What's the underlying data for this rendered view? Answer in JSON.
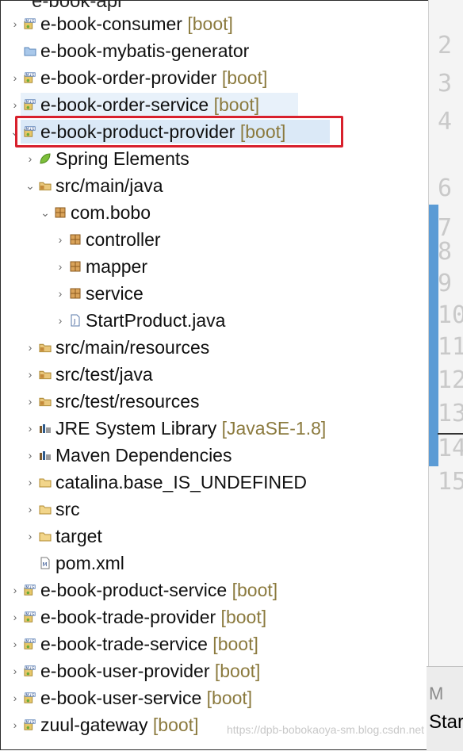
{
  "partial_title": "e-book-api",
  "tree": [
    {
      "label": "e-book-consumer",
      "decoration": "[boot]",
      "icon": "boot-project-icon",
      "arrow": "›",
      "indent": 0
    },
    {
      "label": "e-book-mybatis-generator",
      "decoration": "",
      "icon": "project-folder-icon",
      "arrow": "",
      "indent": 0
    },
    {
      "label": "e-book-order-provider",
      "decoration": "[boot]",
      "icon": "boot-project-icon",
      "arrow": "›",
      "indent": 0
    },
    {
      "label": "e-book-order-service",
      "decoration": "[boot]",
      "icon": "boot-project-icon",
      "arrow": "›",
      "indent": 0
    },
    {
      "label": "e-book-product-provider",
      "decoration": "[boot]",
      "icon": "boot-project-icon",
      "arrow": "⌄",
      "indent": 0
    },
    {
      "label": "Spring Elements",
      "decoration": "",
      "icon": "spring-leaf-icon",
      "arrow": "›",
      "indent": 1
    },
    {
      "label": "src/main/java",
      "decoration": "",
      "icon": "source-folder-icon",
      "arrow": "⌄",
      "indent": 1
    },
    {
      "label": "com.bobo",
      "decoration": "",
      "icon": "package-icon",
      "arrow": "⌄",
      "indent": 2
    },
    {
      "label": "controller",
      "decoration": "",
      "icon": "package-icon",
      "arrow": "›",
      "indent": 3
    },
    {
      "label": "mapper",
      "decoration": "",
      "icon": "package-icon",
      "arrow": "›",
      "indent": 3
    },
    {
      "label": "service",
      "decoration": "",
      "icon": "package-icon",
      "arrow": "›",
      "indent": 3
    },
    {
      "label": "StartProduct.java",
      "decoration": "",
      "icon": "java-file-icon",
      "arrow": "›",
      "indent": 3
    },
    {
      "label": "src/main/resources",
      "decoration": "",
      "icon": "source-folder-icon",
      "arrow": "›",
      "indent": 1
    },
    {
      "label": "src/test/java",
      "decoration": "",
      "icon": "source-folder-icon",
      "arrow": "›",
      "indent": 1
    },
    {
      "label": "src/test/resources",
      "decoration": "",
      "icon": "source-folder-icon",
      "arrow": "›",
      "indent": 1
    },
    {
      "label": "JRE System Library",
      "decoration": "[JavaSE-1.8]",
      "icon": "library-icon",
      "arrow": "›",
      "indent": 1
    },
    {
      "label": "Maven Dependencies",
      "decoration": "",
      "icon": "library-icon",
      "arrow": "›",
      "indent": 1
    },
    {
      "label": "catalina.base_IS_UNDEFINED",
      "decoration": "",
      "icon": "folder-icon",
      "arrow": "›",
      "indent": 1
    },
    {
      "label": "src",
      "decoration": "",
      "icon": "folder-icon",
      "arrow": "›",
      "indent": 1
    },
    {
      "label": "target",
      "decoration": "",
      "icon": "folder-icon",
      "arrow": "›",
      "indent": 1
    },
    {
      "label": "pom.xml",
      "decoration": "",
      "icon": "maven-xml-icon",
      "arrow": "",
      "indent": 1
    },
    {
      "label": "e-book-product-service",
      "decoration": "[boot]",
      "icon": "boot-project-icon",
      "arrow": "›",
      "indent": 0
    },
    {
      "label": "e-book-trade-provider",
      "decoration": "[boot]",
      "icon": "boot-project-icon",
      "arrow": "›",
      "indent": 0
    },
    {
      "label": "e-book-trade-service",
      "decoration": "[boot]",
      "icon": "boot-project-icon",
      "arrow": "›",
      "indent": 0
    },
    {
      "label": "e-book-user-provider",
      "decoration": "[boot]",
      "icon": "boot-project-icon",
      "arrow": "›",
      "indent": 0
    },
    {
      "label": "e-book-user-service",
      "decoration": "[boot]",
      "icon": "boot-project-icon",
      "arrow": "›",
      "indent": 0
    },
    {
      "label": "zuul-gateway",
      "decoration": "[boot]",
      "icon": "boot-project-icon",
      "arrow": "›",
      "indent": 0
    }
  ],
  "selected_index": 4,
  "hovered_index": 3,
  "line_numbers": [
    "2",
    "3",
    "4",
    "6",
    "7",
    "8",
    "9",
    "10",
    "11",
    "12",
    "13",
    "14",
    "15"
  ],
  "editor_tab_partial": "M",
  "editor_tab_start": "Star",
  "watermark": "https://dpb-bobokaoya-sm.blog.csdn.net",
  "colors": {
    "highlight_box": "#d8202c",
    "selection": "#dbe9f7",
    "decoration": "#8b7a3e",
    "scrollbar": "#5b9bd5"
  }
}
